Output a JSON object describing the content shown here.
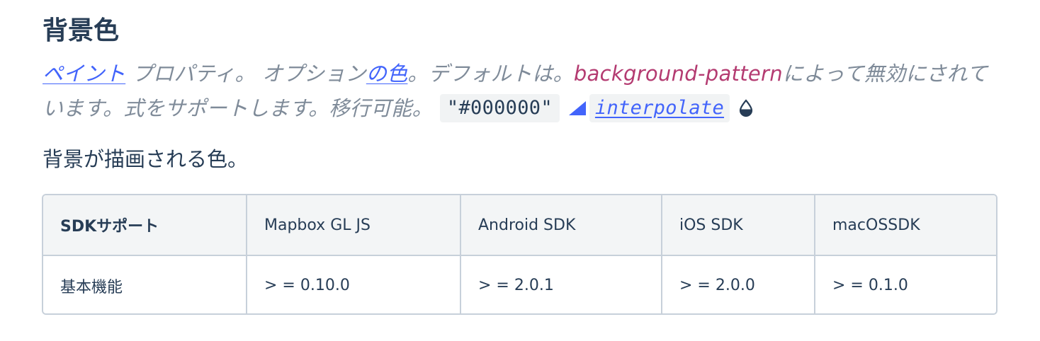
{
  "section": {
    "title": "背景色"
  },
  "meta": {
    "paint_link": "ペイント",
    "text_property": " プロパティ。 オプション",
    "color_link": "の色",
    "text_default": "。デフォルトは。",
    "disabled_by": "background-pattern",
    "text_disabled": "によって無効にされています。式をサポートします。移行可能。",
    "default_value": "\"#000000\"",
    "interpolate_link": "interpolate",
    "accent_color": "#4264fb",
    "icons": [
      "interpolate-triangle-icon",
      "data-drop-icon"
    ]
  },
  "description": "背景が描画される色。",
  "sdk_table": {
    "headers": [
      "SDKサポート",
      "Mapbox GL JS",
      "Android SDK",
      "iOS SDK",
      "macOSSDK"
    ],
    "rows": [
      [
        "基本機能",
        "> = 0.10.0",
        "> = 2.0.1",
        "> = 2.0.0",
        "> = 0.1.0"
      ]
    ]
  }
}
